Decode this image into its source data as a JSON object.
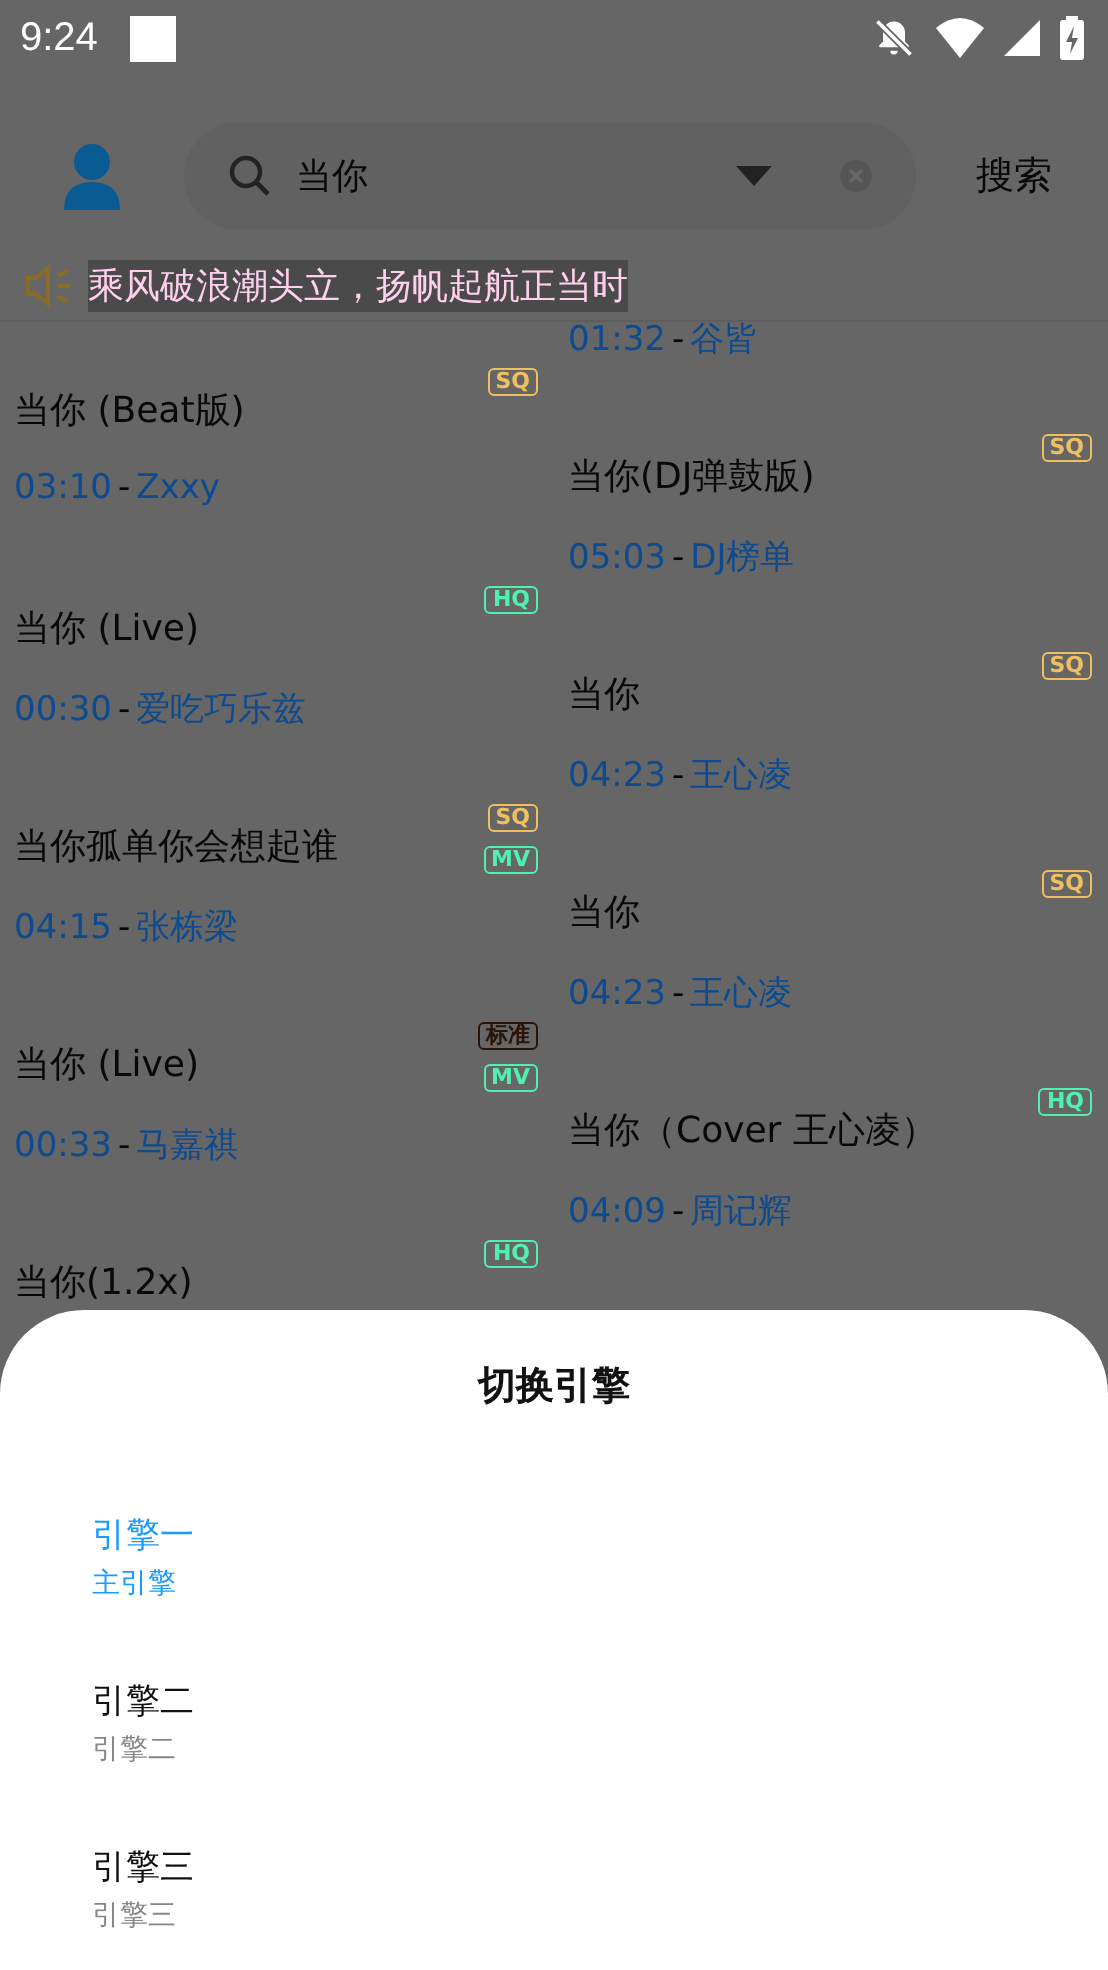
{
  "status_bar": {
    "time": "9:24"
  },
  "header": {
    "search": {
      "value": "当你"
    },
    "search_button": "搜索"
  },
  "announcement": "乘风破浪潮头立，扬帆起航正当时",
  "results": {
    "left": [
      {
        "title": "当你 (Beat版)",
        "duration": "03:10",
        "separator": "-",
        "artist": "Zxxy",
        "badges": [
          {
            "label": "SQ",
            "color": "#f0c060"
          }
        ]
      },
      {
        "title": "当你 (Live)",
        "duration": "00:30",
        "separator": "-",
        "artist": "爱吃巧乐兹",
        "badges": [
          {
            "label": "HQ",
            "color": "#50f0b0"
          }
        ]
      },
      {
        "title": "当你孤单你会想起谁",
        "duration": "04:15",
        "separator": "-",
        "artist": "张栋梁",
        "badges": [
          {
            "label": "SQ",
            "color": "#f0c060"
          },
          {
            "label": "MV",
            "color": "#50f0b0"
          }
        ]
      },
      {
        "title": "当你 (Live)",
        "duration": "00:33",
        "separator": "-",
        "artist": "马嘉祺",
        "badges": [
          {
            "label": "标准",
            "color": "#2a1408"
          },
          {
            "label": "MV",
            "color": "#50f0b0"
          }
        ]
      },
      {
        "title": "当你(1.2x)",
        "badges": [
          {
            "label": "HQ",
            "color": "#50f0b0"
          }
        ]
      }
    ],
    "right": [
      {
        "duration": "01:32",
        "separator": "-",
        "artist": "谷皆"
      },
      {
        "title": "当你(DJ弹鼓版)",
        "duration": "05:03",
        "separator": "-",
        "artist": "DJ榜单",
        "badges": [
          {
            "label": "SQ",
            "color": "#f0c060"
          }
        ]
      },
      {
        "title": "当你",
        "duration": "04:23",
        "separator": "-",
        "artist": "王心凌",
        "badges": [
          {
            "label": "SQ",
            "color": "#f0c060"
          }
        ]
      },
      {
        "title": "当你",
        "duration": "04:23",
        "separator": "-",
        "artist": "王心凌",
        "badges": [
          {
            "label": "SQ",
            "color": "#f0c060"
          }
        ]
      },
      {
        "title": "当你（Cover 王心凌）",
        "duration": "04:09",
        "separator": "-",
        "artist": "周记辉",
        "badges": [
          {
            "label": "HQ",
            "color": "#50f0b0"
          }
        ]
      }
    ]
  },
  "sheet": {
    "title": "切换引擎",
    "engines": [
      {
        "name": "引擎一",
        "subtitle": "主引擎",
        "selected": true
      },
      {
        "name": "引擎二",
        "subtitle": "引擎二",
        "selected": false
      },
      {
        "name": "引擎三",
        "subtitle": "引擎三",
        "selected": false
      }
    ]
  }
}
